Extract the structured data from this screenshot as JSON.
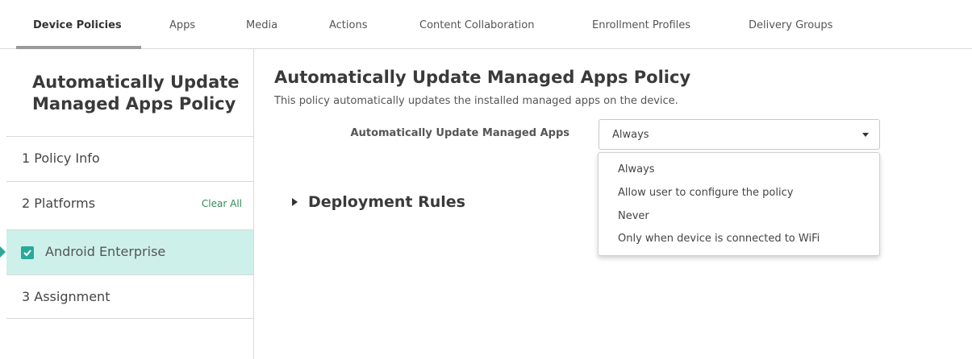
{
  "tabs": [
    {
      "label": "Device Policies",
      "active": true
    },
    {
      "label": "Apps"
    },
    {
      "label": "Media"
    },
    {
      "label": "Actions"
    },
    {
      "label": "Content Collaboration"
    },
    {
      "label": "Enrollment Profiles"
    },
    {
      "label": "Delivery Groups"
    }
  ],
  "sidebar": {
    "title": "Automatically Update Managed Apps Policy",
    "steps": [
      {
        "label": "1  Policy Info"
      },
      {
        "label": "2  Platforms",
        "action": "Clear All"
      },
      {
        "label": "Android Enterprise",
        "checked": true,
        "selected": true
      },
      {
        "label": "3  Assignment"
      }
    ]
  },
  "main": {
    "title": "Automatically Update Managed Apps Policy",
    "description": "This policy automatically updates the installed managed apps on the device.",
    "field_label": "Automatically Update Managed Apps",
    "selected_value": "Always",
    "options": [
      "Always",
      "Allow user to configure the policy",
      "Never",
      "Only when device is connected to WiFi"
    ],
    "section_label": "Deployment Rules"
  },
  "colors": {
    "accent": "#2aa89a",
    "selected_bg": "#cdf0ea",
    "clear_all": "#2e8b57"
  }
}
